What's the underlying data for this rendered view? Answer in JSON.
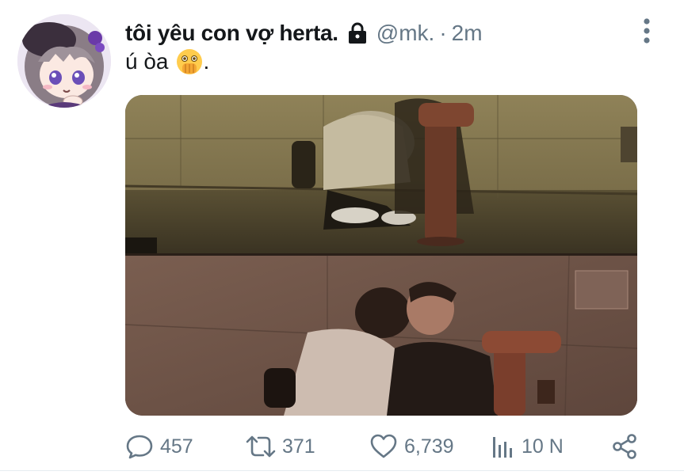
{
  "tweet": {
    "display_name": "tôi yêu con vợ herta.",
    "handle": "@mk.",
    "separator": "·",
    "time": "2m",
    "text": "ú òa",
    "text_suffix": ".",
    "emoji": "face-with-hand-over-mouth-emoji",
    "media_alt": "two-panel photo of two people by a wall and red standpipe"
  },
  "actions": {
    "reply_count": "457",
    "retweet_count": "371",
    "like_count": "6,739",
    "views_count": "10 N"
  },
  "colors": {
    "text_primary": "#14171a",
    "text_secondary": "#657786",
    "divider": "#e6ecf0"
  }
}
